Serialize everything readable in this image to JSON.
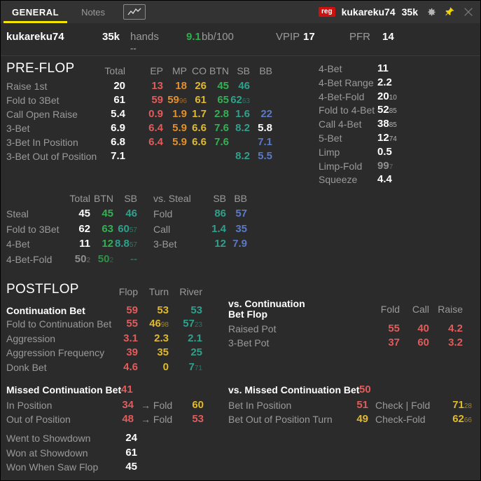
{
  "titlebar": {
    "tab_general": "GENERAL",
    "tab_notes": "Notes",
    "chart_icon": "line-chart-icon",
    "badge": "reg",
    "player": "kukareku74",
    "stack": "35k",
    "gear_icon": "gear-icon",
    "pin_icon": "pin-icon",
    "close_icon": "close-icon",
    "accent": "#f2e600"
  },
  "playerbar": {
    "name": "kukareku74",
    "hands_value": "35k",
    "hands_label": "hands",
    "hands_sub": "--",
    "bb100_value": "9.1",
    "bb100_label": "bb/100",
    "vpip_label": "VPIP",
    "vpip_value": "17",
    "pfr_label": "PFR",
    "pfr_value": "14"
  },
  "preflop": {
    "title": "PRE-FLOP",
    "columns": [
      "Total",
      "EP",
      "MP",
      "CO",
      "BTN",
      "SB",
      "BB"
    ],
    "rows": [
      {
        "label": "Raise 1st",
        "cells": [
          "20",
          "13",
          "18",
          "26",
          "45",
          "46",
          ""
        ]
      },
      {
        "label": "Fold to 3Bet",
        "cells": [
          "61",
          "59",
          "59",
          "61",
          "65",
          "62",
          ""
        ],
        "subs": [
          "",
          "",
          "96",
          "",
          "",
          "63",
          ""
        ]
      },
      {
        "label": "Call Open Raise",
        "cells": [
          "5.4",
          "0.9",
          "1.9",
          "1.7",
          "2.8",
          "1.6",
          "22"
        ]
      },
      {
        "label": "3-Bet",
        "cells": [
          "6.9",
          "6.4",
          "5.9",
          "6.6",
          "7.6",
          "8.2",
          "5.8"
        ],
        "bb_white": true
      },
      {
        "label": "3-Bet In Position",
        "cells": [
          "6.8",
          "6.4",
          "5.9",
          "6.6",
          "7.6",
          "",
          "7.1"
        ]
      },
      {
        "label": "3-Bet Out of Position",
        "cells": [
          "7.1",
          "",
          "",
          "",
          "",
          "8.2",
          "5.5"
        ]
      }
    ]
  },
  "preflop_right": {
    "rows": [
      {
        "label": "4-Bet",
        "value": "11",
        "sub": ""
      },
      {
        "label": "4-Bet Range",
        "value": "2.2",
        "sub": ""
      },
      {
        "label": "4-Bet-Fold",
        "value": "20",
        "sub": "10"
      },
      {
        "label": "Fold to 4-Bet",
        "value": "52",
        "sub": "85"
      },
      {
        "label": "Call 4-Bet",
        "value": "38",
        "sub": "85"
      },
      {
        "label": "5-Bet",
        "value": "12",
        "sub": "74"
      },
      {
        "label": "Limp",
        "value": "0.5",
        "sub": ""
      },
      {
        "label": "Limp-Fold",
        "value": "99",
        "sub": "7",
        "dim": true
      },
      {
        "label": "Squeeze",
        "value": "4.4",
        "sub": ""
      }
    ]
  },
  "steal": {
    "columns": [
      "Total",
      "BTN",
      "SB"
    ],
    "rows": [
      {
        "label": "Steal",
        "cells": [
          "45",
          "45",
          "46"
        ],
        "subs": [
          "",
          "",
          ""
        ]
      },
      {
        "label": "Fold to 3Bet",
        "cells": [
          "62",
          "63",
          "60"
        ],
        "subs": [
          "",
          "",
          "57"
        ]
      },
      {
        "label": "4-Bet",
        "cells": [
          "11",
          "12",
          "8.8"
        ],
        "subs": [
          "",
          "",
          "57"
        ]
      },
      {
        "label": "4-Bet-Fold",
        "cells": [
          "50",
          "50",
          "--"
        ],
        "subs": [
          "2",
          "2",
          ""
        ],
        "dim": true
      }
    ]
  },
  "vs_steal": {
    "title": "vs. Steal",
    "columns": [
      "SB",
      "BB"
    ],
    "rows": [
      {
        "label": "Fold",
        "cells": [
          "86",
          "57"
        ]
      },
      {
        "label": "Call",
        "cells": [
          "1.4",
          "35"
        ]
      },
      {
        "label": "3-Bet",
        "cells": [
          "12",
          "7.9"
        ]
      }
    ]
  },
  "postflop": {
    "title": "POSTFLOP",
    "columns": [
      "Flop",
      "Turn",
      "River"
    ],
    "rows": [
      {
        "label": "Continuation Bet",
        "cells": [
          "59",
          "53",
          "53"
        ],
        "subs": [
          "",
          "",
          ""
        ],
        "hl": true
      },
      {
        "label": "Fold to Continuation Bet",
        "cells": [
          "55",
          "46",
          "57"
        ],
        "subs": [
          "",
          "98",
          "23"
        ]
      },
      {
        "label": "Aggression",
        "cells": [
          "3.1",
          "2.3",
          "2.1"
        ],
        "subs": [
          "",
          "",
          ""
        ]
      },
      {
        "label": "Aggression Frequency",
        "cells": [
          "39",
          "35",
          "25"
        ],
        "subs": [
          "",
          "",
          ""
        ]
      },
      {
        "label": "Donk Bet",
        "cells": [
          "4.6",
          "0",
          "7"
        ],
        "subs": [
          "",
          "",
          "71"
        ]
      }
    ]
  },
  "vs_cbet": {
    "title_line1": "vs. Continuation",
    "title_line2": "Bet Flop",
    "columns": [
      "Fold",
      "Call",
      "Raise"
    ],
    "rows": [
      {
        "label": "Raised Pot",
        "cells": [
          "55",
          "40",
          "4.2"
        ]
      },
      {
        "label": "3-Bet Pot",
        "cells": [
          "37",
          "60",
          "3.2"
        ]
      }
    ]
  },
  "missed_cbet": {
    "title": "Missed Continuation Bet",
    "title_value": "41",
    "rows": [
      {
        "label": "In Position",
        "value": "34",
        "arrow": "→ Fold",
        "fold": "60",
        "fold_color": "#e0b92e"
      },
      {
        "label": "Out of Position",
        "value": "48",
        "arrow": "→ Fold",
        "fold": "53",
        "fold_color": "#e05c5c"
      }
    ]
  },
  "vs_missed_cbet": {
    "title": "vs. Missed Continuation Bet",
    "title_value": "50",
    "rows": [
      {
        "label": "Bet In Position",
        "value": "51",
        "value_color": "#e05c5c",
        "sublabel": "Check | Fold",
        "subvalue": "71",
        "subscript": "28"
      },
      {
        "label": "Bet Out of Position Turn",
        "value": "49",
        "value_color": "#e0b92e",
        "sublabel": "Check-Fold",
        "subvalue": "62",
        "subscript": "66"
      }
    ]
  },
  "showdown": {
    "rows": [
      {
        "label": "Went to Showdown",
        "value": "24"
      },
      {
        "label": "Won at Showdown",
        "value": "61"
      },
      {
        "label": "Won When Saw Flop",
        "value": "45"
      }
    ]
  }
}
